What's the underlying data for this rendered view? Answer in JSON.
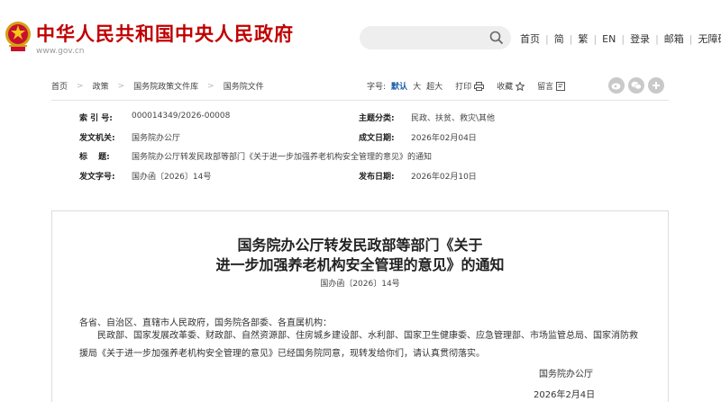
{
  "header": {
    "site_title": "中华人民共和国中央人民政府",
    "site_domain": "www.gov.cn",
    "links": [
      "首页",
      "简",
      "繁",
      "EN",
      "登录",
      "邮箱",
      "无障碍"
    ]
  },
  "breadcrumb": [
    "首页",
    "政策",
    "国务院政策文件库",
    "国务院文件"
  ],
  "font_size": {
    "label": "字号:",
    "options": [
      "默认",
      "大",
      "超大"
    ],
    "selected": "默认"
  },
  "tools": {
    "print": "打印",
    "favorite": "收藏",
    "message": "留言"
  },
  "share": [
    "weibo-icon",
    "wechat-icon",
    "more-icon"
  ],
  "meta": {
    "index_label": "索 引 号:",
    "index_value": "000014349/2026-00008",
    "topic_label": "主题分类:",
    "topic_value": "民政、扶贫、救灾\\其他",
    "issuer_label": "发文机关:",
    "issuer_value": "国务院办公厅",
    "created_label": "成文日期:",
    "created_value": "2026年02月04日",
    "title_label": "标　 题:",
    "title_value": "国务院办公厅转发民政部等部门《关于进一步加强养老机构安全管理的意见》的通知",
    "doc_no_label": "发文字号:",
    "doc_no_value": "国办函〔2026〕14号",
    "publish_label": "发布日期:",
    "publish_value": "2026年02月10日"
  },
  "document": {
    "title_line1": "国务院办公厅转发民政部等部门《关于",
    "title_line2": "进一步加强养老机构安全管理的意见》的通知",
    "doc_number": "国办函〔2026〕14号",
    "salutation": "各省、自治区、直辖市人民政府，国务院各部委、各直属机构：",
    "body": "民政部、国家发展改革委、财政部、自然资源部、住房城乡建设部、水利部、国家卫生健康委、应急管理部、市场监管总局、国家消防救援局《关于进一步加强养老机构安全管理的意见》已经国务院同意，现转发给你们，请认真贯彻落实。",
    "signature": "国务院办公厅",
    "date": "2026年2月4日"
  },
  "colors": {
    "brand": "#c00000",
    "accent": "#1d5da8"
  }
}
